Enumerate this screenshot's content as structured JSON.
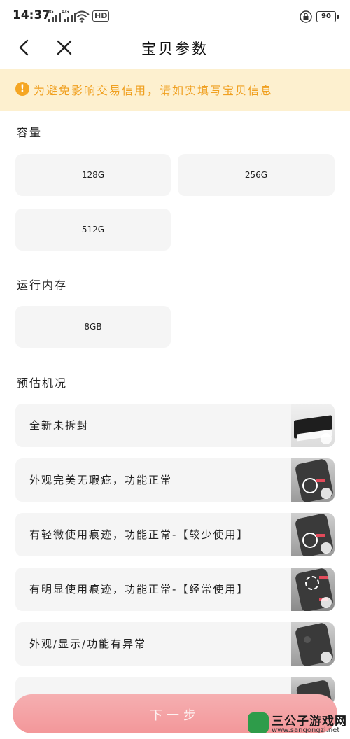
{
  "status_bar": {
    "time": "14:37",
    "signal1_label": "4G",
    "signal2_label": "4G",
    "hd_label": "HD",
    "battery": "90"
  },
  "nav": {
    "title": "宝贝参数"
  },
  "notice": {
    "icon": "!",
    "text": "为避免影响交易信用，请如实填写宝贝信息"
  },
  "capacity": {
    "title": "容量",
    "options": [
      "128G",
      "256G",
      "512G"
    ]
  },
  "memory": {
    "title": "运行内存",
    "options": [
      "8GB"
    ]
  },
  "condition": {
    "title": "预估机况",
    "options": [
      "全新未拆封",
      "外观完美无瑕疵，功能正常",
      "有轻微使用痕迹，功能正常-【较少使用】",
      "有明显使用痕迹，功能正常-【经常使用】",
      "外观/显示/功能有异常"
    ]
  },
  "cta": {
    "label": "下一步"
  },
  "watermark": {
    "name": "三公子游戏网",
    "url": "www.sangongzi.net"
  },
  "colors": {
    "notice_bg": "#fdf0cf",
    "notice_text": "#f0a020",
    "cta_bg": "#f1878a",
    "option_bg": "#f5f5f5"
  }
}
